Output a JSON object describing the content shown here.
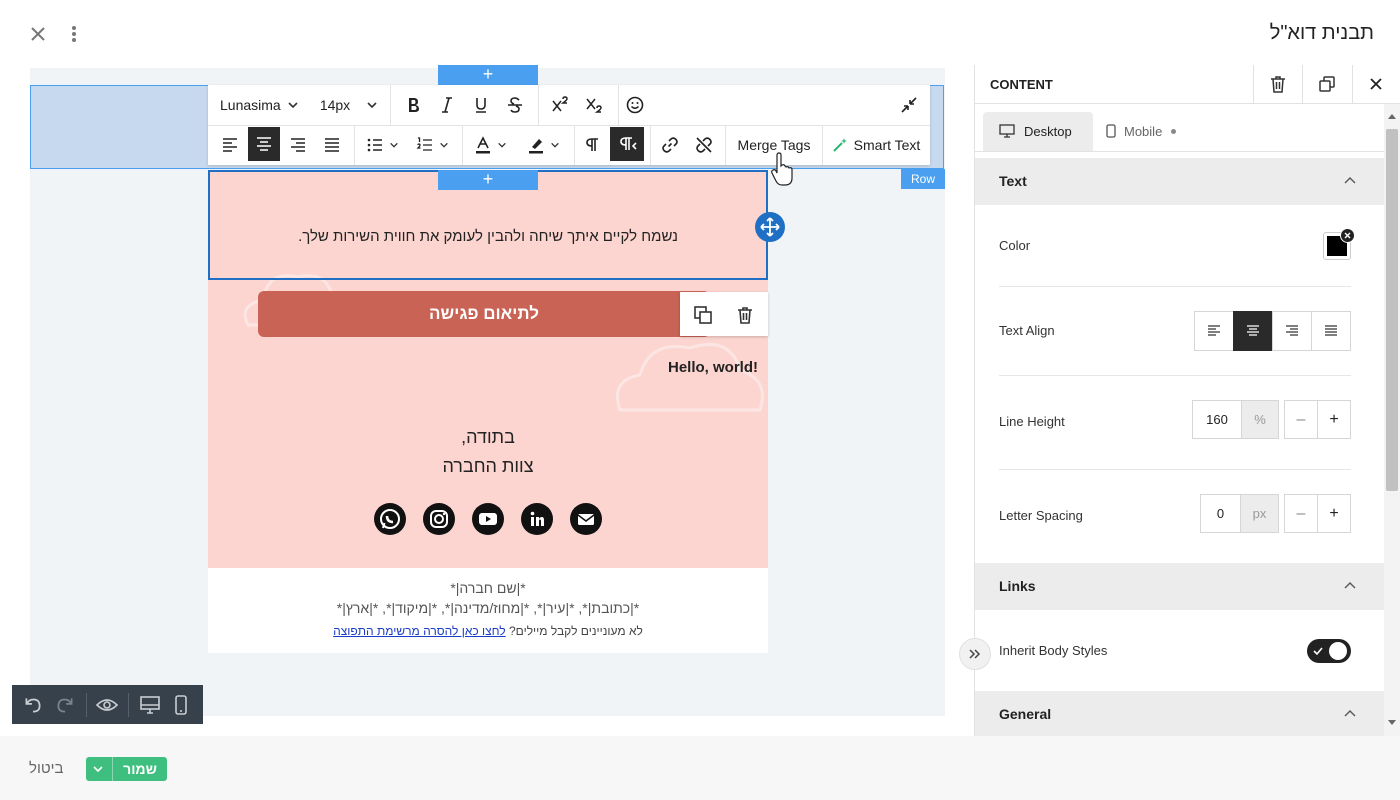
{
  "header": {
    "title": "תבנית דוא\"ל"
  },
  "editor": {
    "plus_symbol": "+",
    "row_tag": "Row",
    "toolbar": {
      "font_family": "Lunasima",
      "font_size": "14px",
      "merge_tags_label": "Merge Tags",
      "smart_text_label": "Smart Text"
    }
  },
  "email": {
    "message_text": "נשמח לקיים איתך שיחה ולהבין לעומק את חווית השירות שלך.",
    "cta_label": "לתיאום פגישה",
    "hello_text": "Hello, world!",
    "signoff_line1": "בתודה,",
    "signoff_line2": "צוות החברה",
    "social_icons": [
      "whatsapp-icon",
      "instagram-icon",
      "youtube-icon",
      "linkedin-icon",
      "email-icon"
    ],
    "footer_company": "*|שם חברה|*",
    "footer_address": "*|כתובת|*, *|עיר|*, *|מחוז/מדינה|*, *|מיקוד|*, *|ארץ|*",
    "footer_unsub_text": "לא מעוניינים לקבל מיילים?",
    "footer_unsub_link": "לחצו כאן להסרה מרשימת התפוצה"
  },
  "bottom_bar": {
    "save_label": "שמור",
    "cancel_label": "ביטול"
  },
  "panel": {
    "title": "CONTENT",
    "tabs": [
      {
        "label": "Desktop",
        "active": true
      },
      {
        "label": "Mobile",
        "active": false
      }
    ],
    "sections": {
      "text": {
        "title": "Text",
        "color_label": "Color",
        "color_value": "#000000",
        "align_label": "Text Align",
        "line_height_label": "Line Height",
        "line_height_value": "160",
        "line_height_unit": "%",
        "letter_spacing_label": "Letter Spacing",
        "letter_spacing_value": "0",
        "letter_spacing_unit": "px",
        "minus": "–",
        "plus": "+"
      },
      "links": {
        "title": "Links",
        "inherit_label": "Inherit Body Styles",
        "inherit_on": true
      },
      "general": {
        "title": "General"
      }
    }
  },
  "colors": {
    "accent": "#4a9ff0",
    "cta": "#c86355",
    "email_bg": "#fdd5d0",
    "save": "#3fbf7f",
    "selection": "#1f6fc5"
  }
}
